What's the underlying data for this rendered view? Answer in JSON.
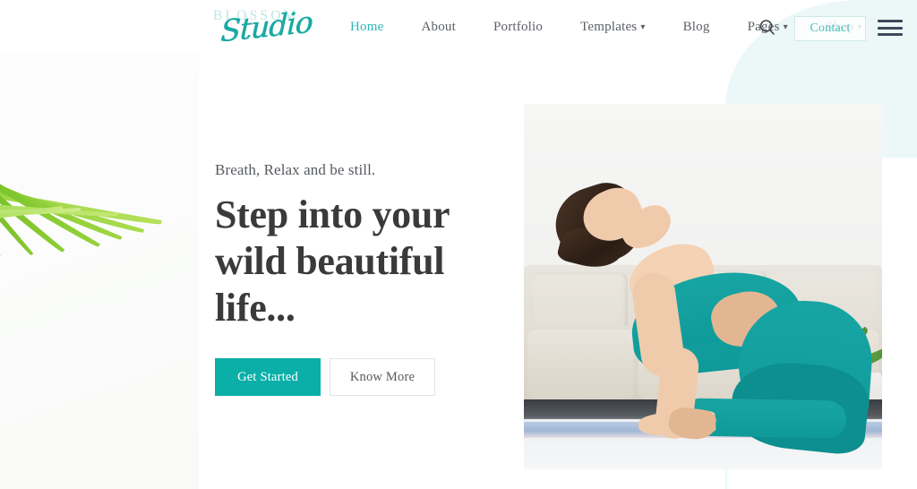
{
  "site": {
    "logo_primary": "BLOSSOM",
    "logo_script": "Studio"
  },
  "header": {
    "nav": [
      {
        "label": "Home",
        "active": true,
        "has_dropdown": false
      },
      {
        "label": "About",
        "active": false,
        "has_dropdown": false
      },
      {
        "label": "Portfolio",
        "active": false,
        "has_dropdown": false
      },
      {
        "label": "Templates",
        "active": false,
        "has_dropdown": true
      },
      {
        "label": "Blog",
        "active": false,
        "has_dropdown": false
      },
      {
        "label": "Pages",
        "active": false,
        "has_dropdown": true
      },
      {
        "label": "Shop",
        "active": false,
        "has_dropdown": true
      }
    ],
    "search_icon": "search-icon",
    "contact_label": "Contact",
    "menu_icon": "hamburger-menu-icon"
  },
  "hero": {
    "eyebrow": "Breath, Relax and be still.",
    "headline": "Step into your wild beautiful life...",
    "primary_cta": "Get Started",
    "secondary_cta": "Know More",
    "image_alt": "Woman in teal yoga outfit performing camel pose on a yoga mat in a living room"
  },
  "colors": {
    "accent_teal": "#0aafa8",
    "nav_active": "#2eb7b5",
    "logo_light": "#bfe6e4",
    "logo_script": "#1ba9a4",
    "heading": "#3a3a3a",
    "body_text": "#5c6066",
    "mint_panel": "#ecf8f8",
    "contact_border": "#cfe9e8",
    "secondary_border": "#e2e4e6",
    "hamburger": "#3c4a5a"
  }
}
